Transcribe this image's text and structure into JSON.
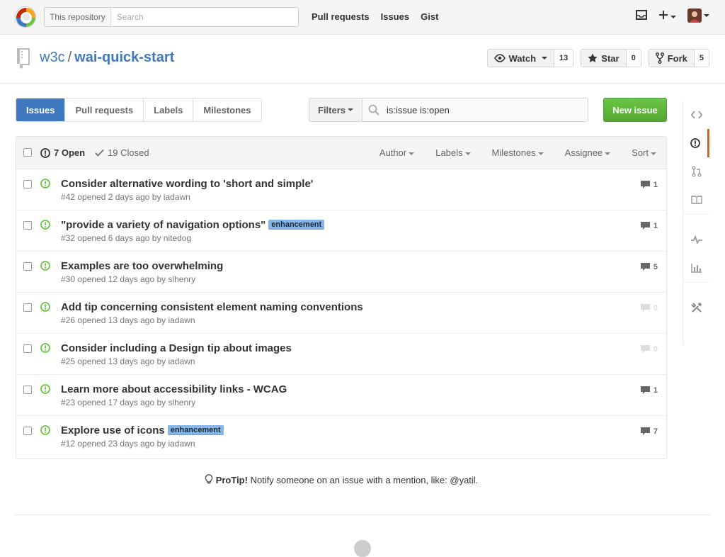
{
  "header": {
    "search_scope": "This repository",
    "search_placeholder": "Search",
    "nav": [
      "Pull requests",
      "Issues",
      "Gist"
    ]
  },
  "repo": {
    "owner": "w3c",
    "separator": "/",
    "name": "wai-quick-start",
    "watch_label": "Watch",
    "watch_count": "13",
    "star_label": "Star",
    "star_count": "0",
    "fork_label": "Fork",
    "fork_count": "5"
  },
  "subnav": {
    "tabs": [
      "Issues",
      "Pull requests",
      "Labels",
      "Milestones"
    ]
  },
  "filter": {
    "button_label": "Filters",
    "query": "is:issue is:open"
  },
  "new_issue_label": "New issue",
  "list": {
    "open_label": "7 Open",
    "closed_label": "19 Closed",
    "sorts": [
      "Author",
      "Labels",
      "Milestones",
      "Assignee",
      "Sort"
    ],
    "issues": [
      {
        "title": "Consider alternative wording to 'short and simple'",
        "label": "",
        "meta": "#42 opened 2 days ago by iadawn",
        "comments": "1"
      },
      {
        "title": "\"provide a variety of navigation options\"",
        "label": "enhancement",
        "meta": "#32 opened 6 days ago by nitedog",
        "comments": "1"
      },
      {
        "title": "Examples are too overwhelming",
        "label": "",
        "meta": "#30 opened 12 days ago by slhenry",
        "comments": "5"
      },
      {
        "title": "Add tip concerning consistent element naming conventions",
        "label": "",
        "meta": "#26 opened 13 days ago by iadawn",
        "comments": "0"
      },
      {
        "title": "Consider including a Design tip about images",
        "label": "",
        "meta": "#25 opened 13 days ago by iadawn",
        "comments": "0"
      },
      {
        "title": "Learn more about accessibility links - WCAG",
        "label": "",
        "meta": "#23 opened 17 days ago by slhenry",
        "comments": "1"
      },
      {
        "title": "Explore use of icons",
        "label": "enhancement",
        "meta": "#12 opened 23 days ago by iadawn",
        "comments": "7"
      }
    ]
  },
  "protip": {
    "bold": "ProTip!",
    "text": " Notify someone on an issue with a mention, like: @yatil."
  },
  "sidebar_icons": [
    "code-icon",
    "issues-icon",
    "pull-request-icon",
    "wiki-icon",
    "pulse-icon",
    "graphs-icon",
    "settings-icon"
  ],
  "colors": {
    "accent": "#4078c0",
    "open_green": "#6cc644",
    "new_issue_green": "#55a532",
    "label_blue": "#84b6eb",
    "sidebar_selected": "#d26911"
  }
}
